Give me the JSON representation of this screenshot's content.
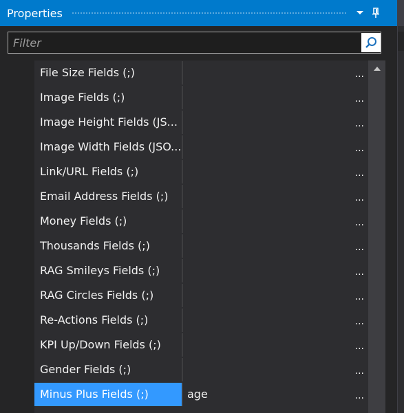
{
  "panel": {
    "title": "Properties"
  },
  "filter": {
    "placeholder": "Filter",
    "value": ""
  },
  "properties": [
    {
      "name": "File Size Fields (;)",
      "value": "",
      "ellipsis": "..."
    },
    {
      "name": "Image Fields (;)",
      "value": "",
      "ellipsis": "..."
    },
    {
      "name": "Image Height Fields (JS...",
      "value": "",
      "ellipsis": "..."
    },
    {
      "name": "Image Width Fields (JSO...",
      "value": "",
      "ellipsis": "..."
    },
    {
      "name": "Link/URL Fields (;)",
      "value": "",
      "ellipsis": "..."
    },
    {
      "name": "Email Address Fields (;)",
      "value": "",
      "ellipsis": "..."
    },
    {
      "name": "Money Fields (;)",
      "value": "",
      "ellipsis": "..."
    },
    {
      "name": "Thousands Fields (;)",
      "value": "",
      "ellipsis": "..."
    },
    {
      "name": "RAG Smileys Fields (;)",
      "value": "",
      "ellipsis": "..."
    },
    {
      "name": "RAG Circles Fields (;)",
      "value": "",
      "ellipsis": "..."
    },
    {
      "name": "Re-Actions Fields (;)",
      "value": "",
      "ellipsis": "..."
    },
    {
      "name": "KPI Up/Down Fields (;)",
      "value": "",
      "ellipsis": "..."
    },
    {
      "name": "Gender Fields (;)",
      "value": "",
      "ellipsis": "..."
    },
    {
      "name": "Minus Plus Fields (;)",
      "value": "age",
      "ellipsis": "...",
      "selected": true
    }
  ],
  "icons": {
    "dropdown": "chevron-down-icon",
    "pin": "pin-icon",
    "search": "search-icon",
    "scroll_up": "scroll-up-arrow-icon"
  },
  "colors": {
    "titlebar": "#007acc",
    "selected": "#3399ff",
    "background": "#252526",
    "row": "#2d2d30"
  }
}
